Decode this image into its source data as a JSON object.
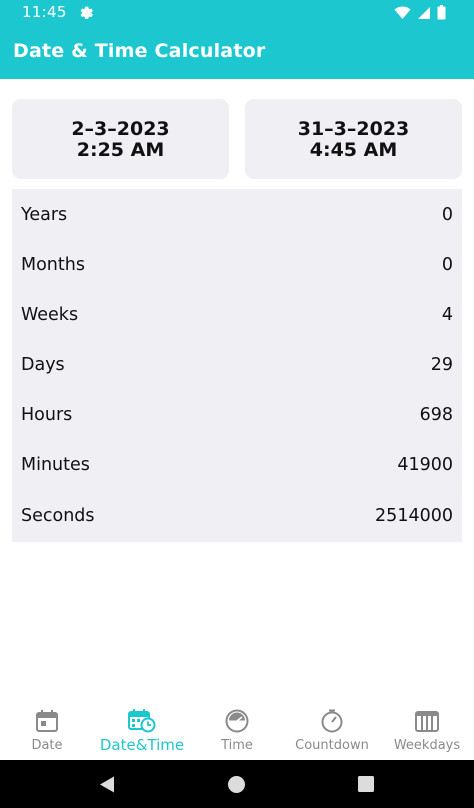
{
  "status_bar": {
    "time": "11:45",
    "icons": [
      "gear-icon",
      "wifi-icon",
      "signal-icon",
      "battery-icon"
    ]
  },
  "app_bar": {
    "title": "Date & Time Calculator"
  },
  "start": {
    "date": "2–3–2023",
    "time": "2:25 AM"
  },
  "end": {
    "date": "31–3–2023",
    "time": "4:45 AM"
  },
  "results": [
    {
      "label": "Years",
      "value": "0"
    },
    {
      "label": "Months",
      "value": "0"
    },
    {
      "label": "Weeks",
      "value": "4"
    },
    {
      "label": "Days",
      "value": "29"
    },
    {
      "label": "Hours",
      "value": "698"
    },
    {
      "label": "Minutes",
      "value": "41900"
    },
    {
      "label": "Seconds",
      "value": "2514000"
    }
  ],
  "bottom_nav": {
    "items": [
      {
        "label": "Date",
        "icon": "calendar-icon",
        "active": false
      },
      {
        "label": "Date&Time",
        "icon": "calendar-clock-icon",
        "active": true
      },
      {
        "label": "Time",
        "icon": "clock-icon",
        "active": false
      },
      {
        "label": "Countdown",
        "icon": "timer-icon",
        "active": false
      },
      {
        "label": "Weekdays",
        "icon": "calendar-grid-icon",
        "active": false
      }
    ]
  },
  "colors": {
    "accent": "#1cc7cf",
    "card_bg": "#efeff4",
    "inactive": "#8a8a8a"
  },
  "system_nav": {
    "icons": [
      "back-icon",
      "home-icon",
      "recents-icon"
    ]
  }
}
